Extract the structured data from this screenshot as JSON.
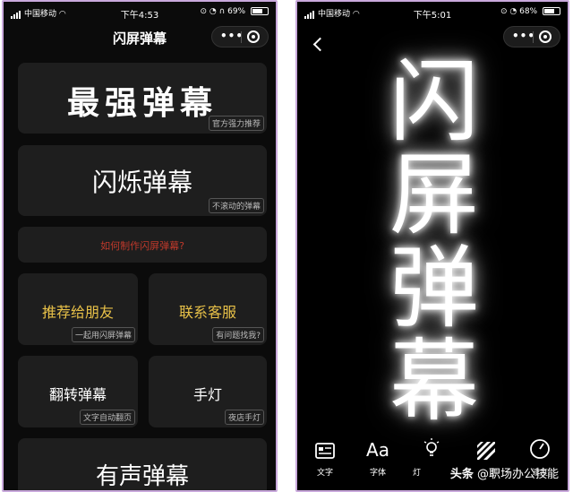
{
  "left": {
    "status": {
      "carrier": "中国移动",
      "time": "下午4:53",
      "battery": "69%",
      "battery_level": 0.69
    },
    "title": "闪屏弹幕",
    "cards": {
      "strongest": {
        "label": "最强弹幕",
        "tag": "官方强力推荐"
      },
      "flash": {
        "label": "闪烁弹幕",
        "tag": "不滚动的弹幕"
      },
      "howto": {
        "label": "如何制作闪屏弹幕?"
      },
      "recommend": {
        "label": "推荐给朋友",
        "tag": "一起用闪屏弹幕"
      },
      "support": {
        "label": "联系客服",
        "tag": "有问题找我?"
      },
      "flip": {
        "label": "翻转弹幕",
        "tag": "文字自动翻页"
      },
      "flashlight": {
        "label": "手灯",
        "tag": "夜店手灯"
      },
      "sound": {
        "label": "有声弹幕"
      }
    },
    "colors": {
      "gold": "#e8c148",
      "red": "#c0392b"
    }
  },
  "right": {
    "status": {
      "carrier": "中国移动",
      "time": "下午5:01",
      "battery": "68%",
      "battery_level": 0.68
    },
    "display_chars": [
      "闪",
      "屏",
      "弹",
      "幕"
    ],
    "toolbar": {
      "text": "文字",
      "font": "字体",
      "font_glyph": "Aa",
      "light": "灯",
      "color": "颜",
      "speed": "速度"
    },
    "watermark": {
      "source": "头条",
      "handle": "@职场办公技能"
    }
  }
}
